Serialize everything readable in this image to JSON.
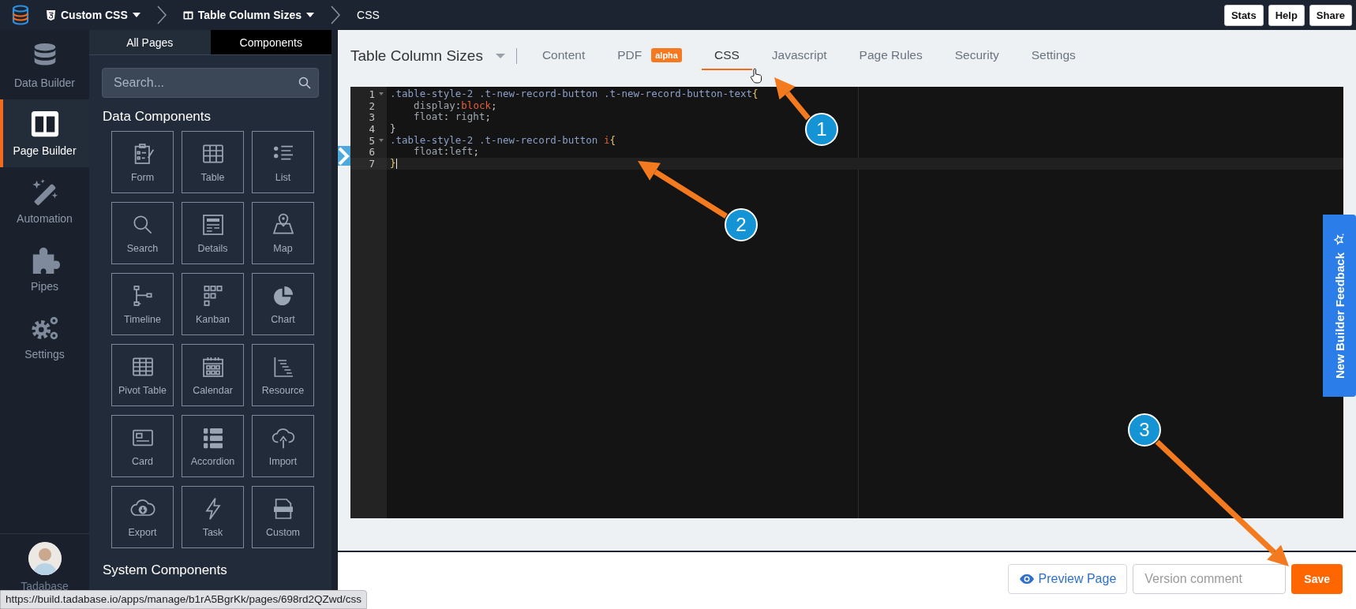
{
  "topbar": {
    "breadcrumbs": [
      {
        "label": "Custom CSS",
        "dropdown": true
      },
      {
        "label": "Table Column Sizes",
        "dropdown": true
      },
      {
        "label": "CSS",
        "dropdown": false
      }
    ],
    "buttons": [
      "Stats",
      "Help",
      "Share"
    ]
  },
  "nav": {
    "items": [
      {
        "label": "Data Builder",
        "selected": false
      },
      {
        "label": "Page Builder",
        "selected": true
      },
      {
        "label": "Automation",
        "selected": false
      },
      {
        "label": "Pipes",
        "selected": false
      },
      {
        "label": "Settings",
        "selected": false
      }
    ],
    "user": "Tadabase"
  },
  "panel": {
    "tabs": [
      {
        "label": "All Pages",
        "selected": false
      },
      {
        "label": "Components",
        "selected": true
      }
    ],
    "search": {
      "placeholder": "Search..."
    },
    "heading": "Data Components",
    "components": [
      "Form",
      "Table",
      "List",
      "Search",
      "Details",
      "Map",
      "Timeline",
      "Kanban",
      "Chart",
      "Pivot Table",
      "Calendar",
      "Resource",
      "Card",
      "Accordion",
      "Import",
      "Export",
      "Task",
      "Custom"
    ],
    "system_heading": "System Components"
  },
  "page": {
    "title": "Table Column Sizes",
    "tabs": [
      {
        "label": "Content",
        "selected": false
      },
      {
        "label": "PDF",
        "badge": "alpha",
        "selected": false
      },
      {
        "label": "CSS",
        "selected": true
      },
      {
        "label": "Javascript",
        "selected": false
      },
      {
        "label": "Page Rules",
        "selected": false
      },
      {
        "label": "Security",
        "selected": false
      },
      {
        "label": "Settings",
        "selected": false
      }
    ]
  },
  "editor": {
    "lines": [
      {
        "number": "1",
        "foldable": true,
        "active": false,
        "tokens": [
          {
            "kind": "selector",
            "text": ".table-style-2 .t-new-record-button .t-new-record-button-text"
          },
          {
            "kind": "brace",
            "text": "{"
          }
        ]
      },
      {
        "number": "2",
        "foldable": false,
        "active": false,
        "tokens": [
          {
            "kind": "property",
            "text": "    display"
          },
          {
            "kind": "punct",
            "text": ":"
          },
          {
            "kind": "keyword",
            "text": "block"
          },
          {
            "kind": "punct",
            "text": ";"
          }
        ]
      },
      {
        "number": "3",
        "foldable": false,
        "active": false,
        "tokens": [
          {
            "kind": "property",
            "text": "    float"
          },
          {
            "kind": "punct",
            "text": ": "
          },
          {
            "kind": "value",
            "text": "right"
          },
          {
            "kind": "punct",
            "text": ";"
          }
        ]
      },
      {
        "number": "4",
        "foldable": false,
        "active": false,
        "tokens": [
          {
            "kind": "punct",
            "text": "}"
          }
        ]
      },
      {
        "number": "5",
        "foldable": true,
        "active": false,
        "tokens": [
          {
            "kind": "selector",
            "text": ".table-style-2 .t-new-record-button "
          },
          {
            "kind": "keyword",
            "text": "i"
          },
          {
            "kind": "brace",
            "text": "{"
          }
        ]
      },
      {
        "number": "6",
        "foldable": false,
        "active": false,
        "tokens": [
          {
            "kind": "property",
            "text": "    float"
          },
          {
            "kind": "punct",
            "text": ":"
          },
          {
            "kind": "value",
            "text": "left"
          },
          {
            "kind": "punct",
            "text": ";"
          }
        ]
      },
      {
        "number": "7",
        "foldable": false,
        "active": true,
        "tokens": [
          {
            "kind": "brace",
            "text": "}"
          }
        ]
      }
    ]
  },
  "footer": {
    "preview_button": "Preview Page",
    "comment": {
      "placeholder": "Version comment"
    },
    "save_button": "Save"
  },
  "feedback_tab": "New Builder Feedback",
  "callouts": [
    {
      "number": "1"
    },
    {
      "number": "2"
    },
    {
      "number": "3"
    }
  ],
  "status_url": "https://build.tadabase.io/apps/manage/b1rA5BgrKk/pages/698rd2QZwd/css"
}
